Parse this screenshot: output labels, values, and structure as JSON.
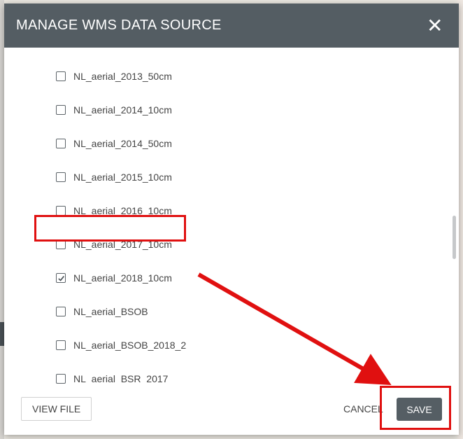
{
  "modal": {
    "title": "MANAGE WMS DATA SOURCE",
    "close_icon": "close-icon"
  },
  "layers": [
    {
      "label": "NL_aerial_2013_50cm",
      "checked": false
    },
    {
      "label": "NL_aerial_2014_10cm",
      "checked": false
    },
    {
      "label": "NL_aerial_2014_50cm",
      "checked": false
    },
    {
      "label": "NL_aerial_2015_10cm",
      "checked": false
    },
    {
      "label": "NL_aerial_2016_10cm",
      "checked": false
    },
    {
      "label": "NL_aerial_2017_10cm",
      "checked": false
    },
    {
      "label": "NL_aerial_2018_10cm",
      "checked": true
    },
    {
      "label": "NL_aerial_BSOB",
      "checked": false
    },
    {
      "label": "NL_aerial_BSOB_2018_2",
      "checked": false
    },
    {
      "label": "NL_aerial_BSR_2017",
      "checked": false
    }
  ],
  "footer": {
    "view_file_label": "VIEW FILE",
    "cancel_label": "CANCEL",
    "save_label": "SAVE"
  },
  "colors": {
    "header": "#545d63",
    "annotation": "#e01010"
  }
}
